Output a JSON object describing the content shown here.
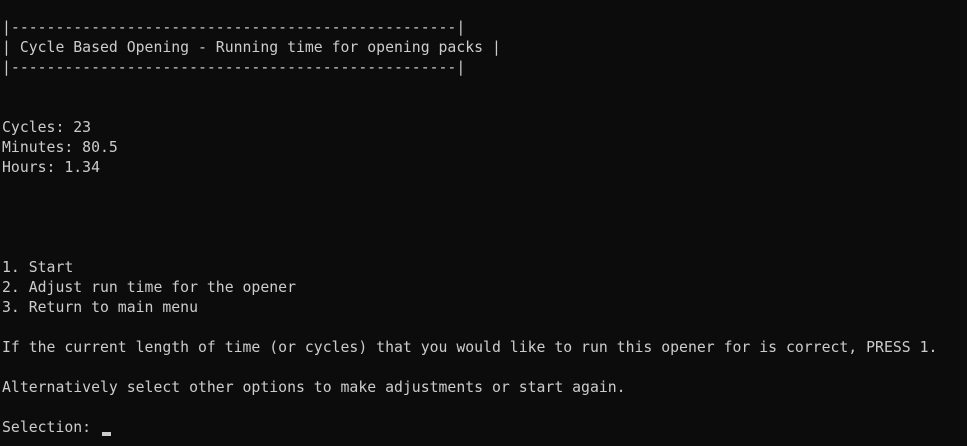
{
  "banner": {
    "top_border": "|--------------------------------------------------|",
    "title": "| Cycle Based Opening - Running time for opening packs |",
    "bottom_border": "|--------------------------------------------------|"
  },
  "stats": {
    "cycles": "Cycles: 23",
    "minutes": "Minutes: 80.5",
    "hours": "Hours: 1.34"
  },
  "menu": {
    "items": [
      "1. Start",
      "2. Adjust run time for the opener",
      "3. Return to main menu"
    ]
  },
  "instructions": {
    "confirm": "If the current length of time (or cycles) that you would like to run this opener for is correct, PRESS 1.",
    "alternative": "Alternatively select other options to make adjustments or start again."
  },
  "prompt": {
    "label": "Selection: ",
    "value": ""
  }
}
